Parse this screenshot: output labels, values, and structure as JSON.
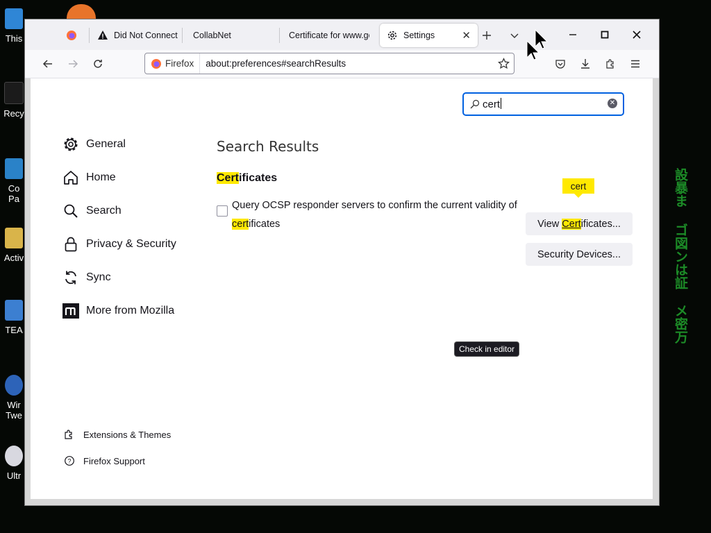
{
  "desktop": {
    "icons": [
      {
        "label": "This"
      },
      {
        "label": "Recy"
      },
      {
        "label": "Co\nPa"
      },
      {
        "label": "Activ"
      },
      {
        "label": "TEA"
      },
      {
        "label": "Wir\nTwe"
      },
      {
        "label": "Ultr"
      }
    ],
    "matrix_columns": [
      "設暴ま",
      "ゴ図ンは証",
      "メ密万"
    ]
  },
  "tabs": [
    {
      "label": ""
    },
    {
      "label": "Did Not Connect:"
    },
    {
      "label": "CollabNet"
    },
    {
      "label": "Certificate for www.go"
    },
    {
      "label": "Settings",
      "active": true
    }
  ],
  "urlbar": {
    "identity_label": "Firefox",
    "url": "about:preferences#searchResults"
  },
  "search": {
    "value": "cert"
  },
  "categories": [
    {
      "id": "general",
      "label": "General"
    },
    {
      "id": "home",
      "label": "Home"
    },
    {
      "id": "search",
      "label": "Search"
    },
    {
      "id": "privacy",
      "label": "Privacy & Security"
    },
    {
      "id": "sync",
      "label": "Sync"
    },
    {
      "id": "mozilla",
      "label": "More from Mozilla"
    }
  ],
  "footer": {
    "extensions": "Extensions & Themes",
    "support": "Firefox Support"
  },
  "results": {
    "heading": "Search Results",
    "group_title_hl": "Cert",
    "group_title_rest": "ificates",
    "checkbox_text_1": "Query OCSP responder servers to confirm the current validity of",
    "checkbox_text_hl": "cert",
    "checkbox_text_2": "ificates",
    "view_btn_pre": "View ",
    "view_btn_hl": "Cert",
    "view_btn_post": "ificates...",
    "devices_btn": "Security Devices...",
    "callout": "cert"
  },
  "tooltip": "Check in editor",
  "colors": {
    "accent": "#0061e0",
    "highlight": "#ffe900",
    "matrix": "#1f9a2b"
  }
}
